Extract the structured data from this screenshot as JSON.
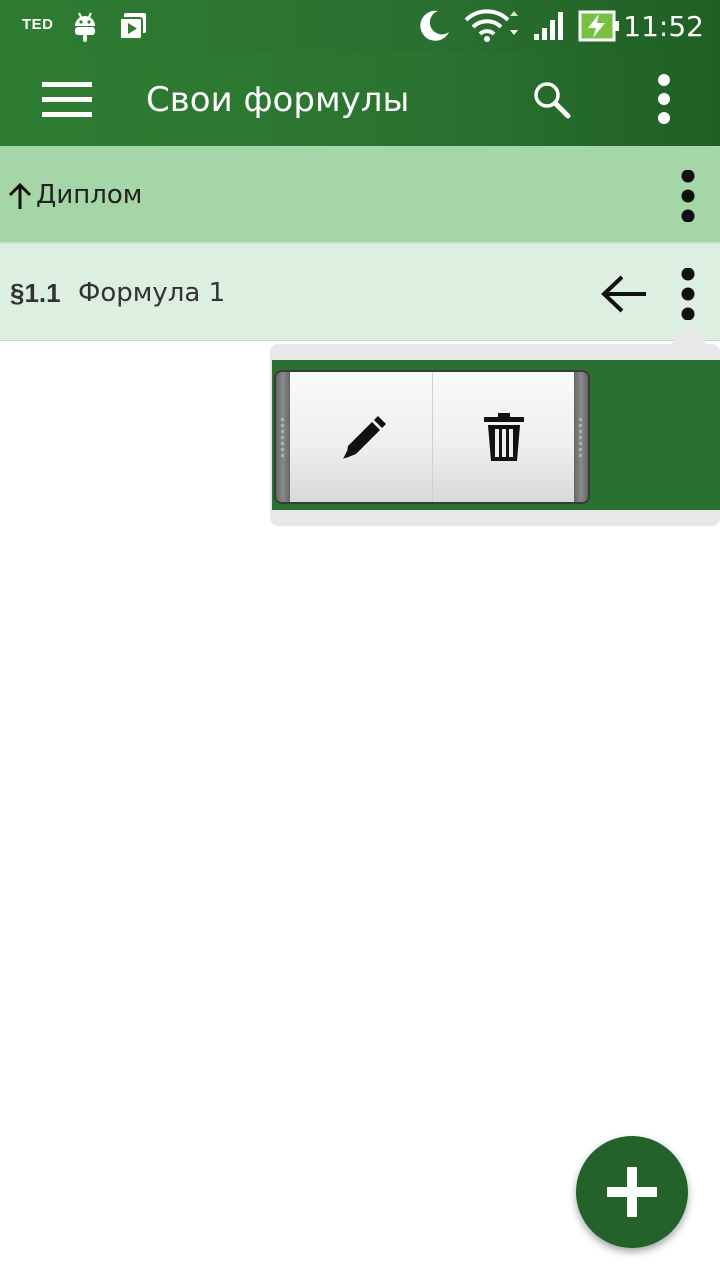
{
  "status_bar": {
    "carrier_badge": "TED",
    "time": "11:52",
    "icons": [
      "android-icon",
      "video-icon",
      "moon-icon",
      "wifi-icon",
      "signal-icon",
      "battery-charging-icon"
    ]
  },
  "toolbar": {
    "title": "Свои формулы",
    "icons": [
      "menu-icon",
      "search-icon",
      "more-vert-icon"
    ]
  },
  "folder_row": {
    "label": "Диплом",
    "icons": [
      "arrow-up-icon",
      "more-vert-icon"
    ]
  },
  "formula_row": {
    "number": "§1.1",
    "name": "Формула 1",
    "icons": [
      "arrow-left-icon",
      "more-vert-icon"
    ]
  },
  "context_menu": {
    "actions": [
      "edit-icon",
      "trash-icon"
    ]
  },
  "fab": {
    "icon": "plus-icon",
    "color": "#23622a"
  },
  "colors": {
    "primary": "#2e7d32",
    "folder_row": "#a5d6a7",
    "formula_row": "#dcefe0"
  }
}
